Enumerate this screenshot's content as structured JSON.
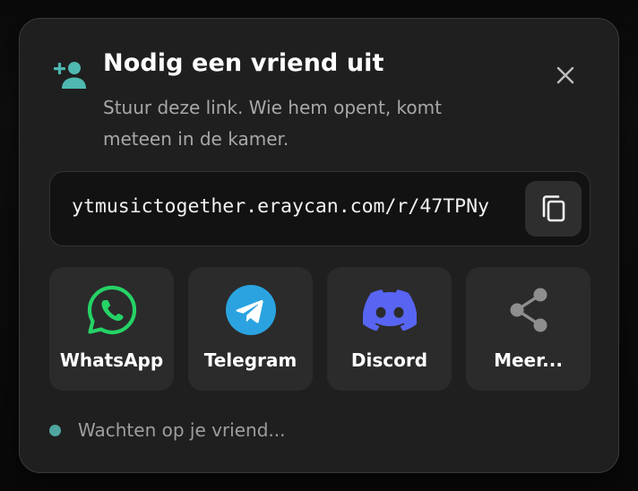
{
  "dialog": {
    "title": "Nodig een vriend uit",
    "subtitle": "Stuur deze link. Wie hem opent, komt meteen in de kamer.",
    "header_icon": "person-add-icon",
    "close_icon": "close-icon",
    "accent_color": "#4fb8b0"
  },
  "link": {
    "url": "ytmusictogether.eraycan.com/r/47TPNy",
    "copy_icon": "copy-icon"
  },
  "share": [
    {
      "label": "WhatsApp",
      "icon": "whatsapp-icon",
      "color": "#25d366"
    },
    {
      "label": "Telegram",
      "icon": "telegram-icon",
      "color": "#2aa3e0"
    },
    {
      "label": "Discord",
      "icon": "discord-icon",
      "color": "#5865f2"
    },
    {
      "label": "Meer...",
      "icon": "share-icon",
      "color": "#8e8e8e"
    }
  ],
  "status": {
    "text": "Wachten op je vriend...",
    "dot_color": "#4fa5a0"
  }
}
